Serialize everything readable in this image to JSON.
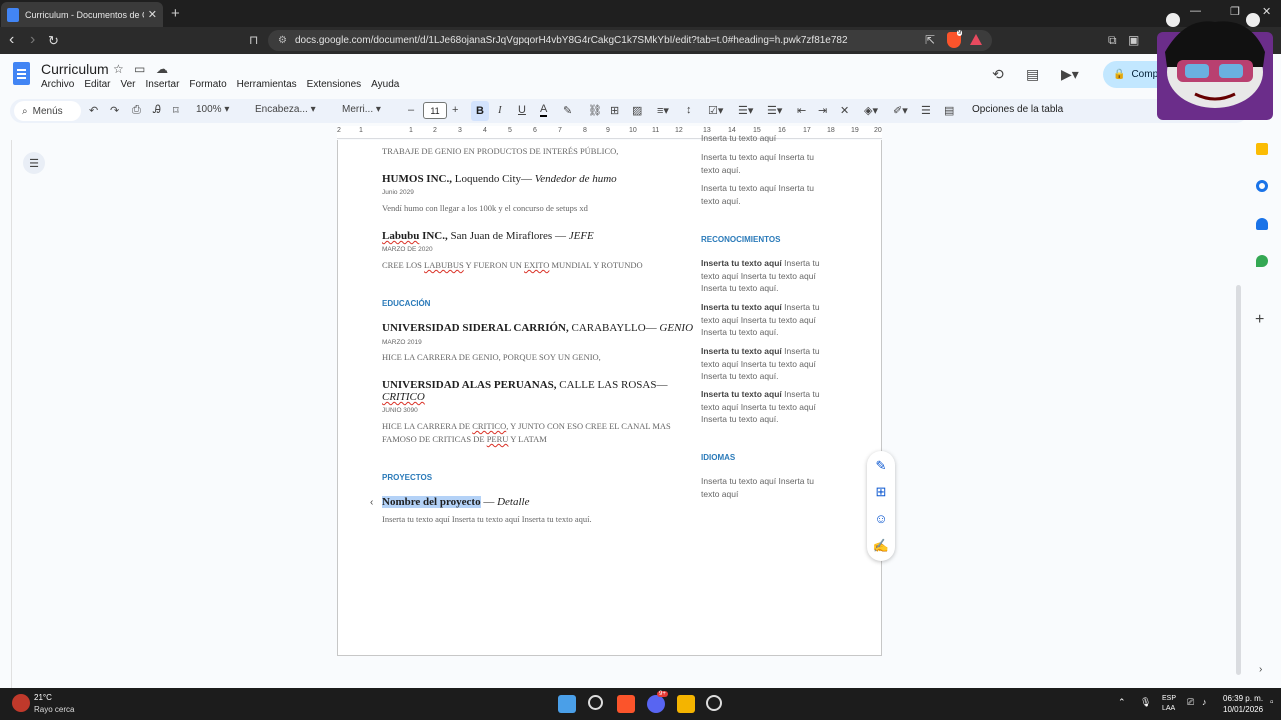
{
  "browser": {
    "tab_title": "Curriculum - Documentos de Go",
    "url": "docs.google.com/document/d/1LJe68ojanaSrJqVgpqorH4vbY8G4rCakgC1k7SMkYbI/edit?tab=t.0#heading=h.pwk7zf81e782",
    "brave_badge": "9"
  },
  "docs": {
    "title": "Curriculum",
    "menu": [
      "Archivo",
      "Editar",
      "Ver",
      "Insertar",
      "Formato",
      "Herramientas",
      "Extensiones",
      "Ayuda"
    ],
    "share_label": "Comp"
  },
  "toolbar": {
    "menus": "Menús",
    "zoom": "100%",
    "style": "Encabeza...",
    "font": "Merri...",
    "size": "11",
    "table_options": "Opciones de la tabla"
  },
  "ruler": [
    "2",
    "1",
    "1",
    "2",
    "3",
    "4",
    "5",
    "6",
    "7",
    "8",
    "9",
    "10",
    "11",
    "12",
    "13",
    "14",
    "15",
    "16",
    "17",
    "18",
    "19",
    "20"
  ],
  "left_col": {
    "top_line": "TRABAJE DE GENIO EN PRODUCTOS DE INTERÉS PÚBLICO,",
    "job1": {
      "company": "HUMOS INC.,",
      "place": " Loquendo City— ",
      "role": "Vendedor de humo",
      "date": "Junio 2029",
      "desc": "Vendí humo con llegar a los 100k y el concurso de setups xd"
    },
    "job2": {
      "company_a": "Labubu",
      "company_b": " INC.,",
      "place": " San Juan de Miraflores — ",
      "role": "JEFE",
      "date": "MARZO DE 2020",
      "desc_a": "CREE LOS ",
      "desc_b": "LABUBUS",
      "desc_c": " Y FUERON UN ",
      "desc_d": "EXITO",
      "desc_e": " MUNDIAL Y ROTUNDO"
    },
    "education_heading": "EDUCACIÓN",
    "edu1": {
      "name": "UNIVERSIDAD SIDERAL CARRIÓN,",
      "place": " CARABAYLLO— ",
      "role": "GENIO",
      "date": "MARZO 2019",
      "desc": "HICE LA CARRERA DE GENIO, PORQUE SOY UN GENIO,"
    },
    "edu2": {
      "name": "UNIVERSIDAD ALAS PERUANAS,",
      "place": " CALLE LAS ROSAS—",
      "role": "CRITICO",
      "date": "JUNIO 3090",
      "desc1_a": "HICE LA CARRERA DE ",
      "desc1_b": "CRITICO",
      "desc1_c": ", Y JUNTO CON ESO CREE EL CANAL MAS",
      "desc2_a": "FAMOSO DE CRITICAS DE ",
      "desc2_b": "PERU",
      "desc2_c": " Y LATAM"
    },
    "projects_heading": "PROYECTOS",
    "project": {
      "name": "Nombre del proyecto",
      "sep": " — ",
      "detail": "Detalle",
      "desc": "Inserta tu texto aquí Inserta tu texto aquí Inserta tu texto aquí."
    }
  },
  "right_col": {
    "top1": "Inserta tu texto aquí",
    "top2": "Inserta tu texto aquí Inserta tu texto aquí.",
    "top3": "Inserta tu texto aquí Inserta tu texto aquí.",
    "recognitions_heading": "RECONOCIMIENTOS",
    "recognitions": [
      {
        "bold": "Inserta tu texto aquí",
        "rest": " Inserta tu texto aquí Inserta tu texto aquí Inserta tu texto aquí."
      },
      {
        "bold": "Inserta tu texto aquí",
        "rest": " Inserta tu texto aquí Inserta tu texto aquí Inserta tu texto aquí."
      },
      {
        "bold": "Inserta tu texto aquí",
        "rest": " Inserta tu texto aquí Inserta tu texto aquí Inserta tu texto aquí."
      },
      {
        "bold": "Inserta tu texto aquí",
        "rest": " Inserta tu texto aquí Inserta tu texto aquí Inserta tu texto aquí."
      }
    ],
    "languages_heading": "IDIOMAS",
    "languages_text": "Inserta tu texto aquí Inserta tu texto aquí"
  },
  "taskbar": {
    "temp": "21°C",
    "condition": "Rayo cerca",
    "lang1": "ESP",
    "lang2": "LAA",
    "time": "06:39 p. m.",
    "date": "10/01/2026",
    "discord_badge": "9+"
  },
  "colors": {
    "accent": "#2a7ab9",
    "selection": "#b4d2f7",
    "share": "#c2e7ff"
  }
}
